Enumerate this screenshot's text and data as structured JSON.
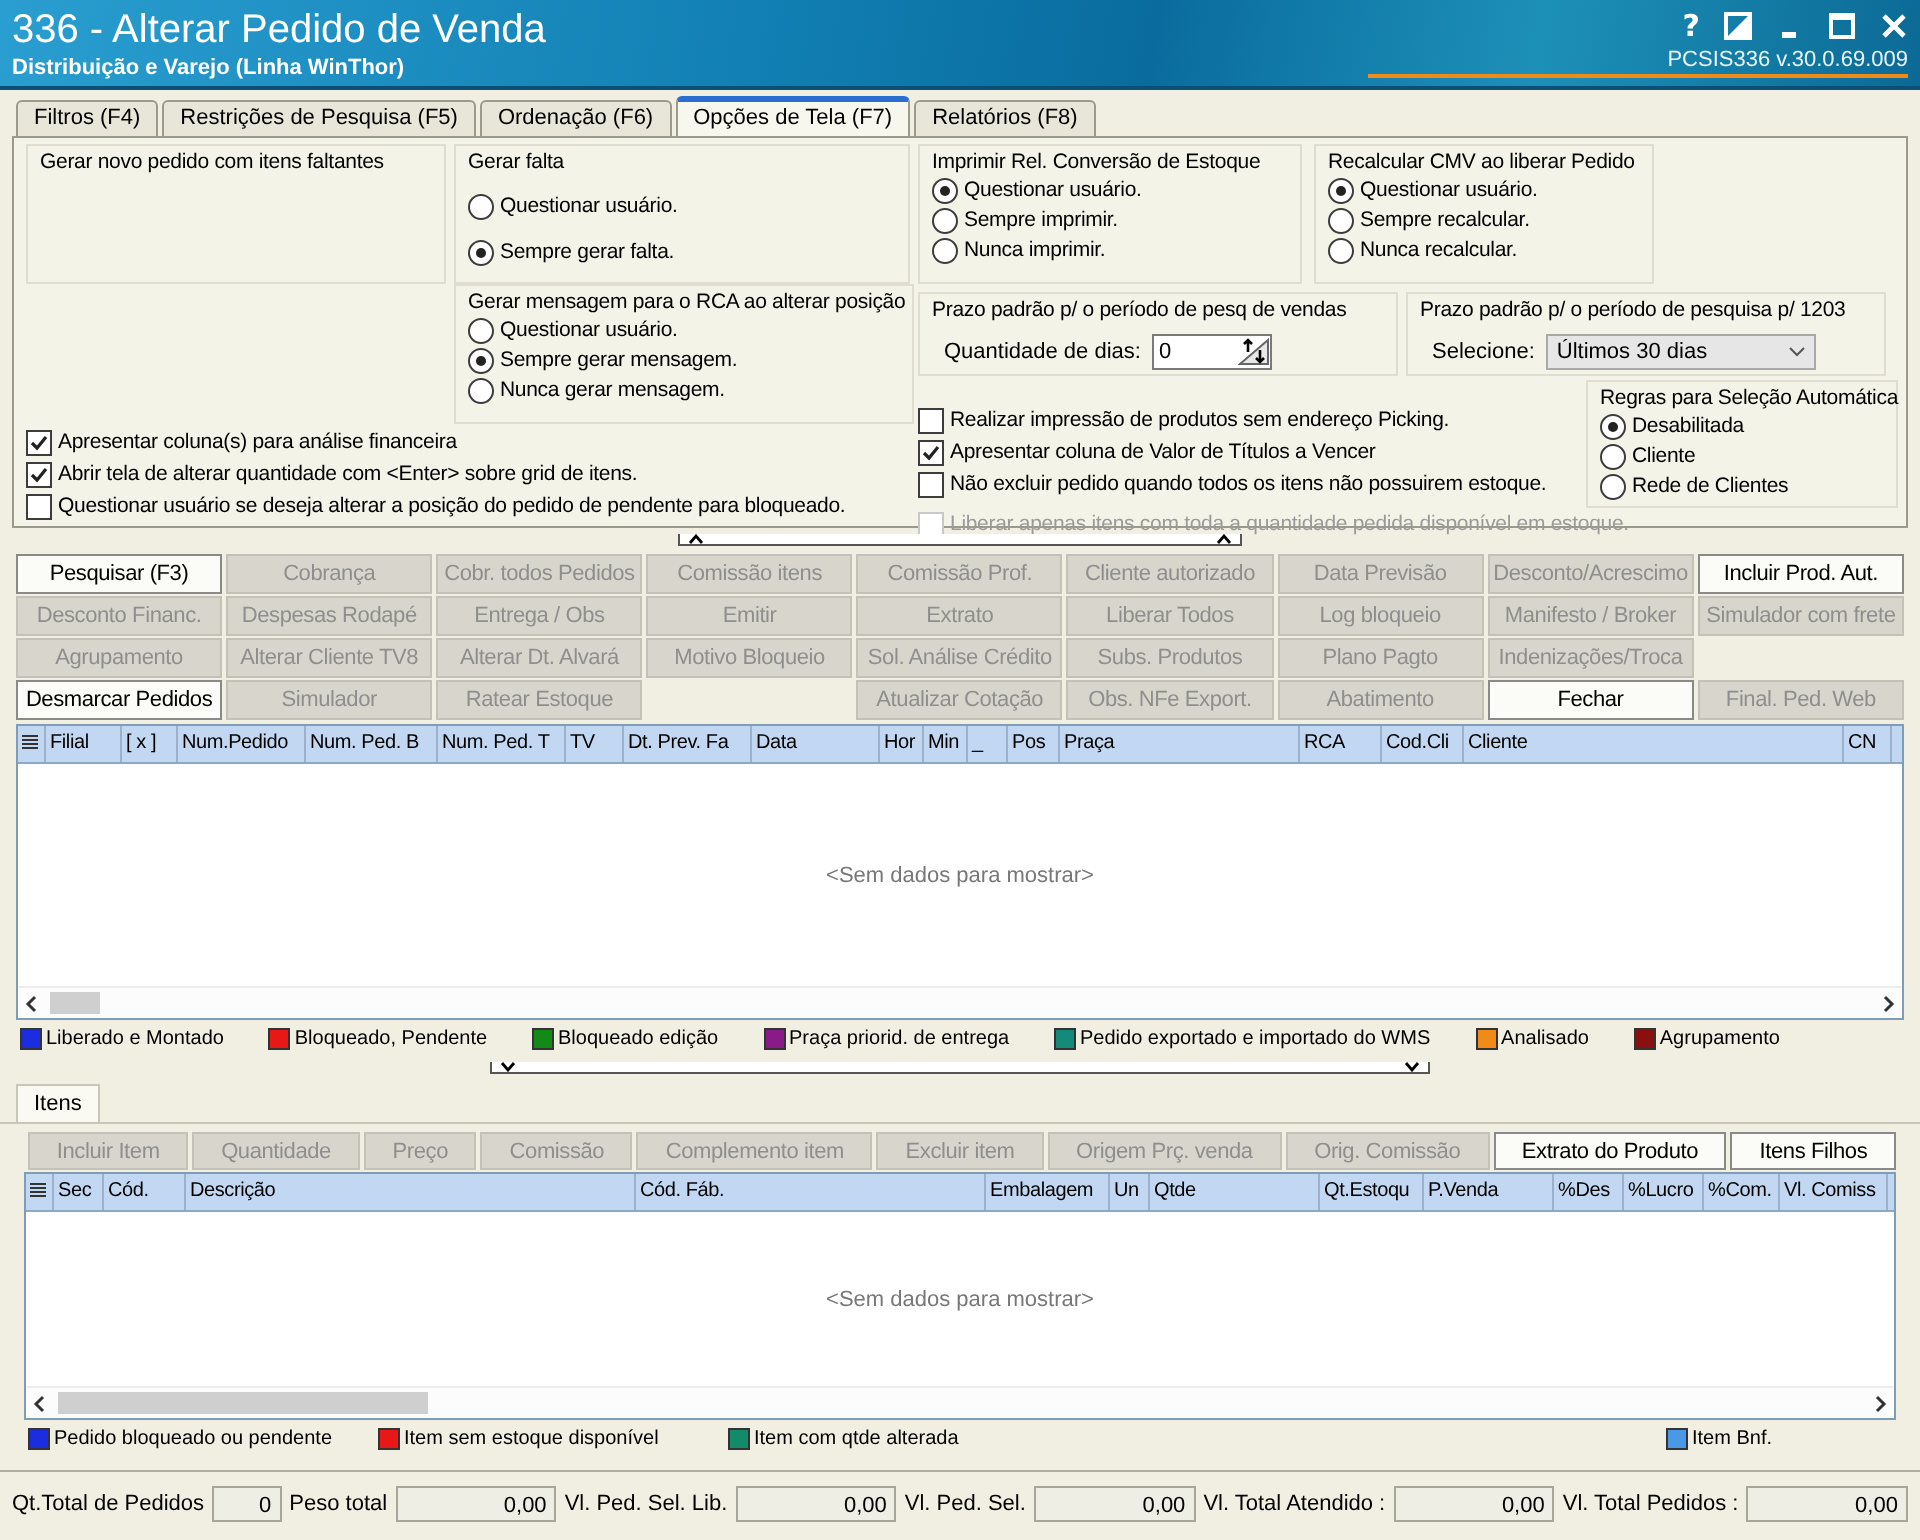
{
  "window": {
    "title": "336 - Alterar Pedido de Venda",
    "subtitle": "Distribuição e Varejo (Linha WinThor)",
    "help_button": "?",
    "version": "PCSIS336  v.30.0.69.009"
  },
  "tabs": [
    {
      "label": "Filtros (F4)",
      "selected": false
    },
    {
      "label": "Restrições de Pesquisa (F5)",
      "selected": false
    },
    {
      "label": "Ordenação (F6)",
      "selected": false
    },
    {
      "label": "Opções de Tela (F7)",
      "selected": true
    },
    {
      "label": "Relatórios (F8)",
      "selected": false
    }
  ],
  "options": {
    "novo_pedido": {
      "title": "Gerar novo pedido com itens faltantes"
    },
    "gerar_falta": {
      "title": "Gerar falta",
      "options": [
        {
          "label": "Questionar usuário.",
          "selected": false
        },
        {
          "label": "Sempre gerar falta.",
          "selected": true
        }
      ]
    },
    "mensagem_rca": {
      "title": "Gerar mensagem para o RCA ao alterar posição",
      "options": [
        {
          "label": "Questionar usuário.",
          "selected": false
        },
        {
          "label": "Sempre gerar mensagem.",
          "selected": true
        },
        {
          "label": "Nunca gerar mensagem.",
          "selected": false
        }
      ]
    },
    "imprimir_conversao": {
      "title": "Imprimir Rel. Conversão de Estoque",
      "options": [
        {
          "label": "Questionar usuário.",
          "selected": true
        },
        {
          "label": "Sempre imprimir.",
          "selected": false
        },
        {
          "label": "Nunca imprimir.",
          "selected": false
        }
      ]
    },
    "recalcular_cmv": {
      "title": "Recalcular CMV ao liberar Pedido",
      "options": [
        {
          "label": "Questionar usuário.",
          "selected": true
        },
        {
          "label": "Sempre recalcular.",
          "selected": false
        },
        {
          "label": "Nunca recalcular.",
          "selected": false
        }
      ]
    },
    "prazo_vendas": {
      "title": "Prazo padrão p/ o período de pesq de vendas",
      "label": "Quantidade de dias:",
      "value": "0"
    },
    "prazo_1203": {
      "title": "Prazo padrão p/ o período de pesquisa p/ 1203",
      "label": "Selecione:",
      "value": "Últimos 30 dias"
    },
    "selecao_automatica": {
      "title": "Regras para Seleção Automática",
      "options": [
        {
          "label": "Desabilitada",
          "selected": true
        },
        {
          "label": "Cliente",
          "selected": false
        },
        {
          "label": "Rede de Clientes",
          "selected": false
        }
      ]
    },
    "checks_left": [
      {
        "label": "Apresentar coluna(s) para análise financeira",
        "checked": true
      },
      {
        "label": "Abrir tela de alterar quantidade com <Enter> sobre grid de itens.",
        "checked": true
      },
      {
        "label": "Questionar usuário se deseja alterar a posição do pedido de pendente para bloqueado.",
        "checked": false
      }
    ],
    "checks_middle": [
      {
        "label": "Realizar impressão de produtos sem endereço Picking.",
        "checked": false,
        "disabled": false
      },
      {
        "label": "Apresentar coluna de Valor de Títulos a Vencer",
        "checked": true,
        "disabled": false
      },
      {
        "label": "Não excluir pedido quando todos os itens não possuirem estoque.",
        "checked": false,
        "disabled": false
      },
      {
        "label": "Liberar apenas itens com toda a quantidade pedida disponível em estoque.",
        "checked": false,
        "disabled": true
      }
    ]
  },
  "action_buttons": [
    [
      {
        "kind": "button",
        "label": "Pesquisar (F3)",
        "disabled": false
      },
      {
        "kind": "button",
        "label": "Cobrança",
        "disabled": true
      },
      {
        "kind": "button",
        "label": "Cobr. todos Pedidos",
        "disabled": true
      },
      {
        "kind": "button",
        "label": "Comissão itens",
        "disabled": true
      },
      {
        "kind": "button",
        "label": "Comissão Prof.",
        "disabled": true
      },
      {
        "kind": "button",
        "label": "Cliente autorizado",
        "disabled": true
      },
      {
        "kind": "button",
        "label": "Data Previsão",
        "disabled": true
      },
      {
        "kind": "button",
        "label": "Desconto/Acrescimo",
        "disabled": true
      },
      {
        "kind": "button",
        "label": "Incluir Prod. Aut.",
        "disabled": false
      }
    ],
    [
      {
        "kind": "button",
        "label": "Desconto Financ.",
        "disabled": true
      },
      {
        "kind": "button",
        "label": "Despesas Rodapé",
        "disabled": true
      },
      {
        "kind": "button",
        "label": "Entrega / Obs",
        "disabled": true
      },
      {
        "kind": "button",
        "label": "Emitir",
        "disabled": true
      },
      {
        "kind": "button",
        "label": "Extrato",
        "disabled": true
      },
      {
        "kind": "button",
        "label": "Liberar Todos",
        "disabled": true
      },
      {
        "kind": "button",
        "label": "Log bloqueio",
        "disabled": true
      },
      {
        "kind": "button",
        "label": "Manifesto / Broker",
        "disabled": true
      },
      {
        "kind": "button",
        "label": "Simulador com frete",
        "disabled": true
      }
    ],
    [
      {
        "kind": "button",
        "label": "Agrupamento",
        "disabled": true
      },
      {
        "kind": "button",
        "label": "Alterar Cliente TV8",
        "disabled": true
      },
      {
        "kind": "button",
        "label": "Alterar Dt. Alvará",
        "disabled": true
      },
      {
        "kind": "button",
        "label": "Motivo Bloqueio",
        "disabled": true
      },
      {
        "kind": "button",
        "label": "Sol. Análise Crédito",
        "disabled": true
      },
      {
        "kind": "button",
        "label": "Subs. Produtos",
        "disabled": true
      },
      {
        "kind": "button",
        "label": "Plano Pagto",
        "disabled": true
      },
      {
        "kind": "button",
        "label": "Indenizações/Troca",
        "disabled": true
      }
    ],
    [
      {
        "kind": "button",
        "label": "Desmarcar Pedidos",
        "disabled": false
      },
      {
        "kind": "button",
        "label": "Simulador",
        "disabled": true
      },
      {
        "kind": "button",
        "label": "Ratear Estoque",
        "disabled": true
      },
      {
        "kind": "gap"
      },
      {
        "kind": "button",
        "label": "Atualizar Cotação",
        "disabled": true
      },
      {
        "kind": "button",
        "label": "Obs. NFe Export.",
        "disabled": true
      },
      {
        "kind": "button",
        "label": "Abatimento",
        "disabled": true
      },
      {
        "kind": "button",
        "label": "Fechar",
        "disabled": false
      },
      {
        "kind": "button",
        "label": "Final. Ped. Web",
        "disabled": true
      }
    ]
  ],
  "orders_grid": {
    "columns": [
      "Filial",
      "[ x ]",
      "Num.Pedido",
      "Num. Ped. B",
      "Num. Ped. T",
      "TV",
      "Dt. Prev. Fa",
      "Data",
      "Hor",
      "Min",
      "_",
      "Pos",
      "Praça",
      "RCA",
      "Cod.Cli",
      "Cliente",
      "CN"
    ],
    "empty_text": "<Sem dados para mostrar>"
  },
  "orders_legend": [
    {
      "label": "Liberado e Montado",
      "color": "#1a2ee0"
    },
    {
      "label": "Bloqueado, Pendente",
      "color": "#e81818"
    },
    {
      "label": "Bloqueado edição",
      "color": "#118a18"
    },
    {
      "label": "Praça priorid. de entrega",
      "color": "#8a1a8a"
    },
    {
      "label": "Pedido exportado e importado do WMS",
      "color": "#138a7a"
    },
    {
      "label": "Analisado",
      "color": "#f08a18"
    },
    {
      "label": "Agrupamento",
      "color": "#8a1010"
    }
  ],
  "items_tabs": [
    {
      "label": "Itens",
      "selected": true
    }
  ],
  "item_buttons": [
    {
      "label": "Incluir Item",
      "disabled": true
    },
    {
      "label": "Quantidade",
      "disabled": true
    },
    {
      "label": "Preço",
      "disabled": true
    },
    {
      "label": "Comissão",
      "disabled": true
    },
    {
      "label": "Complemento item",
      "disabled": true
    },
    {
      "label": "Excluir item",
      "disabled": true
    },
    {
      "label": "Origem Prç. venda",
      "disabled": true
    },
    {
      "label": "Orig. Comissão",
      "disabled": true
    },
    {
      "label": "Extrato do Produto",
      "disabled": false
    },
    {
      "label": "Itens Filhos",
      "disabled": false
    }
  ],
  "items_grid": {
    "columns": [
      "Sec",
      "Cód.",
      "Descrição",
      "Cód. Fáb.",
      "Embalagem",
      "Un",
      "Qtde",
      "Qt.Estoqu",
      "P.Venda",
      "%Des",
      "%Lucro",
      "%Com.",
      "Vl. Comiss"
    ],
    "empty_text": "<Sem dados para mostrar>"
  },
  "items_legend": [
    {
      "label": "Pedido bloqueado ou pendente",
      "color": "#1a2ee0"
    },
    {
      "label": "Item sem estoque disponível",
      "color": "#e81818"
    },
    {
      "label": "Item com qtde alterada",
      "color": "#138a6a"
    },
    {
      "label": "Item Bnf.",
      "color": "#4a98e8"
    }
  ],
  "totals": [
    {
      "label": "Qt.Total de Pedidos",
      "value": "0"
    },
    {
      "label": "Peso total",
      "value": "0,00"
    },
    {
      "label": "Vl. Ped. Sel. Lib.",
      "value": "0,00"
    },
    {
      "label": "Vl. Ped. Sel.",
      "value": "0,00"
    },
    {
      "label": "Vl. Total Atendido :",
      "value": "0,00"
    },
    {
      "label": "Vl. Total Pedidos :",
      "value": "0,00"
    }
  ]
}
